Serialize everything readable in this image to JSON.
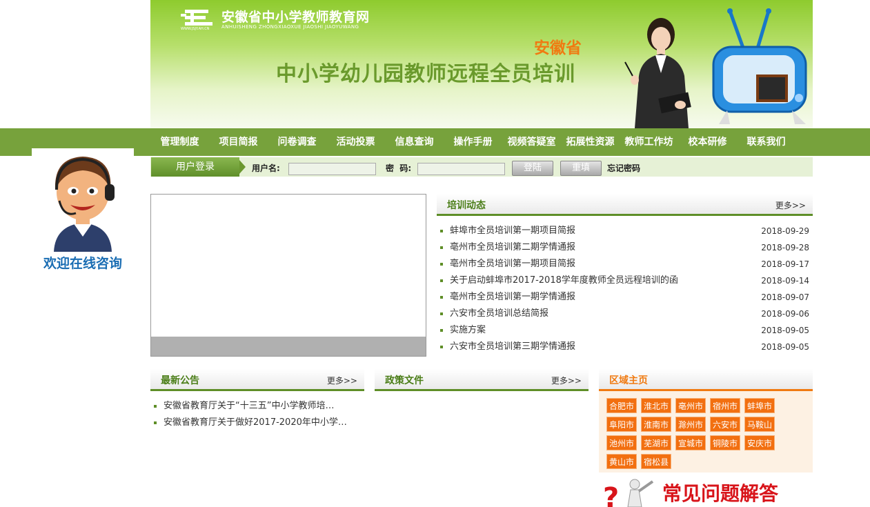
{
  "header": {
    "logo_title": "安徽省中小学教师教育网",
    "logo_subtitle": "ANHUISHENG ZHONGXIAOXUE JIAOSHI JIAOYUWANG",
    "logo_url": "WWW.JSJY.AH.CN",
    "region": "安徽省",
    "title": "中小学幼儿园教师远程全员培训"
  },
  "nav": [
    "管理制度",
    "项目简报",
    "问卷调查",
    "活动投票",
    "信息查询",
    "操作手册",
    "视频答疑室",
    "拓展性资源",
    "教师工作坊",
    "校本研修",
    "联系我们"
  ],
  "consult": {
    "label": "欢迎在线咨询"
  },
  "login": {
    "tab": "用户登录",
    "username_label": "用户名:",
    "password_label": "密  码:",
    "login_button": "登陆",
    "reset_button": "重填",
    "forgot": "忘记密码"
  },
  "training_news": {
    "title": "培训动态",
    "more": "更多>>",
    "items": [
      {
        "title": "蚌埠市全员培训第一期项目简报",
        "date": "2018-09-29"
      },
      {
        "title": "亳州市全员培训第二期学情通报",
        "date": "2018-09-28"
      },
      {
        "title": "亳州市全员培训第一期项目简报",
        "date": "2018-09-17"
      },
      {
        "title": "关于启动蚌埠市2017-2018学年度教师全员远程培训的函",
        "date": "2018-09-14"
      },
      {
        "title": "亳州市全员培训第一期学情通报",
        "date": "2018-09-07"
      },
      {
        "title": "六安市全员培训总结简报",
        "date": "2018-09-06"
      },
      {
        "title": "实施方案",
        "date": "2018-09-05"
      },
      {
        "title": "六安市全员培训第三期学情通报",
        "date": "2018-09-05"
      }
    ]
  },
  "notices": {
    "title": "最新公告",
    "more": "更多>>",
    "items": [
      "安徽省教育厅关于“十三五”中小学教师培…",
      "安徽省教育厅关于做好2017-2020年中小学…"
    ]
  },
  "policy": {
    "title": "政策文件",
    "more": "更多>>"
  },
  "regions": {
    "title": "区域主页",
    "items": [
      "合肥市",
      "淮北市",
      "亳州市",
      "宿州市",
      "蚌埠市",
      "阜阳市",
      "淮南市",
      "滁州市",
      "六安市",
      "马鞍山",
      "池州市",
      "芜湖市",
      "宣城市",
      "铜陵市",
      "安庆市",
      "黄山市",
      "宿松县"
    ]
  },
  "faq": {
    "label": "常见问题解答"
  },
  "colors": {
    "nav_green": "#77a23c",
    "accent_orange": "#f07a11",
    "heading_green": "#4a7d17",
    "consult_blue": "#1a6db3",
    "faq_red": "#d8141a"
  }
}
